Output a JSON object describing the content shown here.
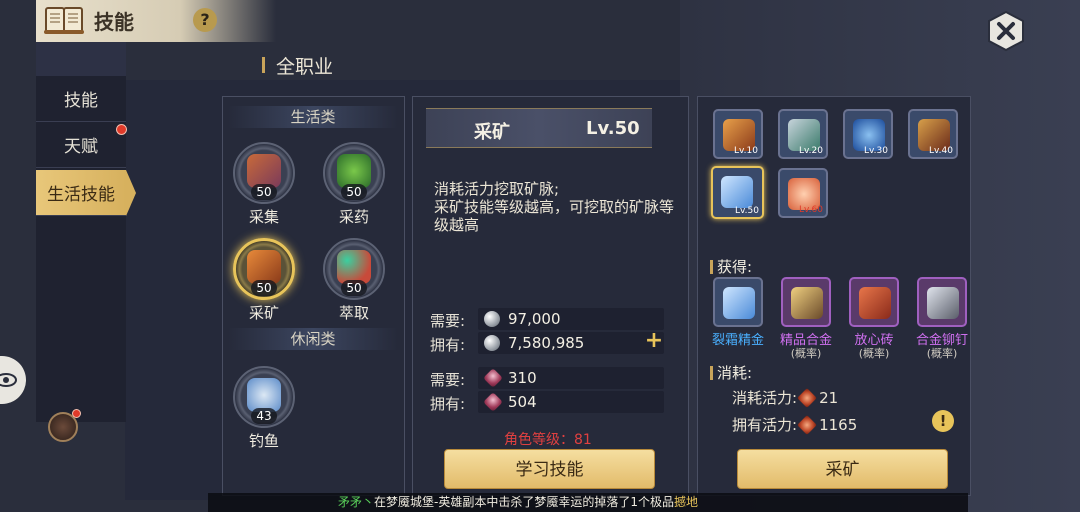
{
  "header": {
    "title": "技能",
    "help_icon": "question-icon",
    "close_icon": "close-icon"
  },
  "tabs": [
    {
      "label": "技能",
      "active": false,
      "badge": false
    },
    {
      "label": "天赋",
      "active": false,
      "badge": true
    },
    {
      "label": "生活技能",
      "active": true,
      "badge": false
    }
  ],
  "section_title": "全职业",
  "categories": {
    "life": "生活类",
    "leisure": "休闲类"
  },
  "skills": [
    {
      "label": "采集",
      "level": "50",
      "selected": false
    },
    {
      "label": "采药",
      "level": "50",
      "selected": false
    },
    {
      "label": "采矿",
      "level": "50",
      "selected": true
    },
    {
      "label": "萃取",
      "level": "50",
      "selected": false
    },
    {
      "label": "钓鱼",
      "level": "43",
      "selected": false
    }
  ],
  "detail": {
    "name": "采矿",
    "level": "Lv.50",
    "description": "消耗活力挖取矿脉;\n采矿技能等级越高，可挖取的矿脉等级越高",
    "silver_need_label": "需要:",
    "silver_need": "97,000",
    "silver_have_label": "拥有:",
    "silver_have": "7,580,985",
    "gem_need_label": "需要:",
    "gem_need": "310",
    "gem_have_label": "拥有:",
    "gem_have": "504",
    "role_level": "角色等级：81",
    "learn_button": "学习技能"
  },
  "ores": [
    {
      "level": "Lv.10",
      "selected": false,
      "locked": false,
      "color": "#c86a2a"
    },
    {
      "level": "Lv.20",
      "selected": false,
      "locked": false,
      "color": "#6aa0b0"
    },
    {
      "level": "Lv.30",
      "selected": false,
      "locked": false,
      "color": "#3a6ab8"
    },
    {
      "level": "Lv.40",
      "selected": false,
      "locked": false,
      "color": "#b86a3a"
    },
    {
      "level": "Lv.50",
      "selected": true,
      "locked": false,
      "color": "#6a9ad8"
    },
    {
      "level": "Lv.60",
      "selected": false,
      "locked": true,
      "color": "#e8906a"
    }
  ],
  "rewards_title": "获得:",
  "rewards": [
    {
      "name": "裂霜精金",
      "sub": "",
      "color": "#4ab0ff",
      "art": "#6aa8e8"
    },
    {
      "name": "精品合金",
      "sub": "(概率)",
      "color": "#d070f0",
      "art": "#c8a060"
    },
    {
      "name": "放心砖",
      "sub": "(概率)",
      "color": "#d070f0",
      "art": "#c85a3a"
    },
    {
      "name": "合金铆钉",
      "sub": "(概率)",
      "color": "#d070f0",
      "art": "#a0a4ac"
    }
  ],
  "consume_title": "消耗:",
  "consume": {
    "cost_label": "消耗活力:",
    "cost_value": "21",
    "have_label": "拥有活力:",
    "have_value": "1165"
  },
  "mine_button": "采矿",
  "ticker": {
    "nick": "矛矛丶",
    "text": "在梦魇城堡-英雄副本中击杀了梦魇幸运的掉落了1个极品",
    "item": "撼地"
  }
}
